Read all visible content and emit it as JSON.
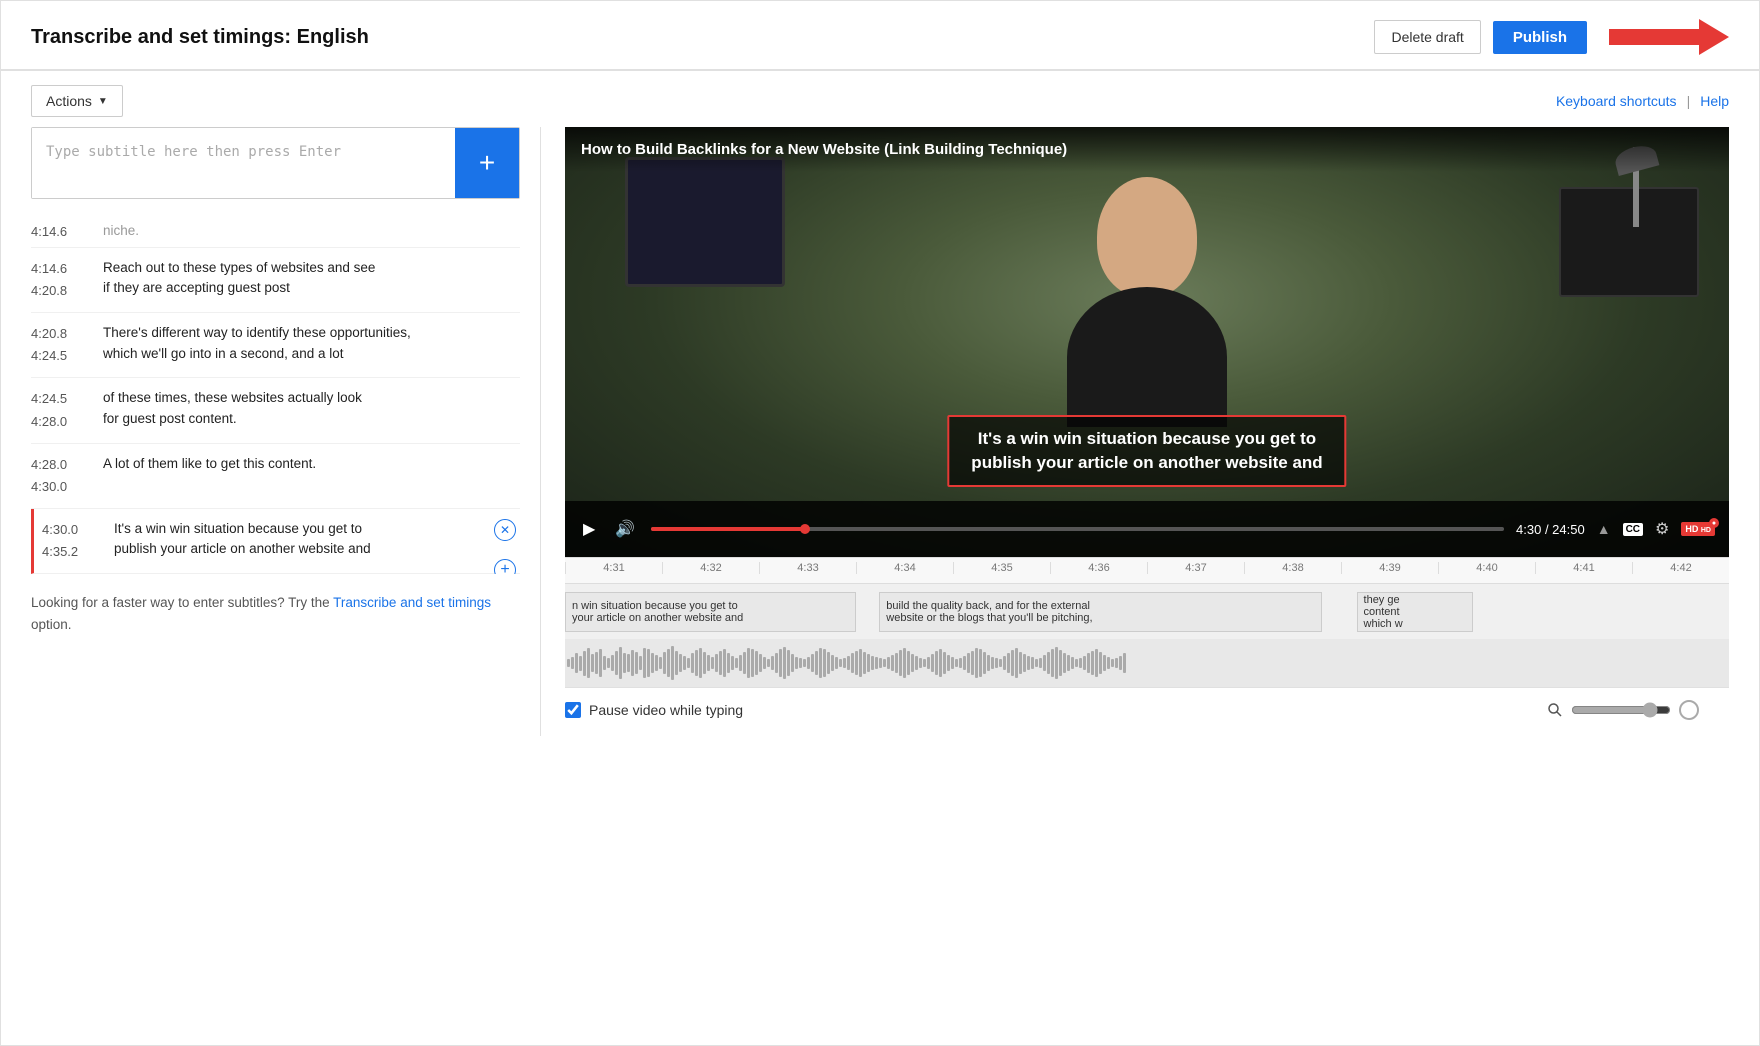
{
  "header": {
    "title": "Transcribe and set timings: English",
    "delete_draft_label": "Delete draft",
    "publish_label": "Publish"
  },
  "toolbar": {
    "actions_label": "Actions",
    "keyboard_shortcuts_label": "Keyboard shortcuts",
    "help_label": "Help"
  },
  "subtitle_input": {
    "placeholder": "Type subtitle here then press Enter",
    "add_button_label": "+"
  },
  "subtitle_items": [
    {
      "time_start": "",
      "time_end": "",
      "text": "niche.",
      "time_label": "4:14.6",
      "partial": true
    },
    {
      "time_start": "4:14.6",
      "time_end": "4:20.8",
      "text": "Reach out to these types of websites and see\nif they are accepting guest post"
    },
    {
      "time_start": "4:20.8",
      "time_end": "4:24.5",
      "text": "There's different way to identify these opportunities,\nwhich we'll go into in a second, and a lot"
    },
    {
      "time_start": "4:24.5",
      "time_end": "4:28.0",
      "text": "of these times, these websites actually look\nfor guest post content."
    },
    {
      "time_start": "4:28.0",
      "time_end": "4:30.0",
      "text": "A lot of them like to get this content."
    },
    {
      "time_start": "4:30.0",
      "time_end": "4:35.2",
      "text": "It's a win win situation because you get to\npublish your article on another website and",
      "active": true
    }
  ],
  "footer_note": {
    "text_before": "Looking for a faster way to enter subtitles? Try the ",
    "link_label": "Transcribe and set timings",
    "text_after": " option."
  },
  "video": {
    "title": "How to Build Backlinks for a New Website (Link Building Technique)",
    "subtitle_overlay_line1": "It's a win win situation because you get to",
    "subtitle_overlay_line2": "publish your article on another website and",
    "time_current": "4:30",
    "time_total": "24:50",
    "time_display": "4:30 / 24:50"
  },
  "timeline": {
    "ruler_marks": [
      "4:31",
      "4:32",
      "4:33",
      "4:34",
      "4:35",
      "4:36",
      "4:37",
      "4:38",
      "4:39",
      "4:40",
      "4:41",
      "4:42"
    ],
    "subtitle_blocks": [
      {
        "text": "n win situation because you get to\nyour article on another website and",
        "left_pct": 0,
        "width_pct": 24
      },
      {
        "text": "build the quality back, and for the external\nwebsite or the blogs that you'll be pitching,",
        "left_pct": 27,
        "width_pct": 38
      },
      {
        "text": "they ge\ncontent\nwhich w",
        "left_pct": 67,
        "width_pct": 10
      }
    ]
  },
  "bottom_controls": {
    "pause_label": "Pause video while typing",
    "pause_checked": true
  },
  "red_arrow": {
    "aria": "Arrow pointing to Publish button"
  }
}
